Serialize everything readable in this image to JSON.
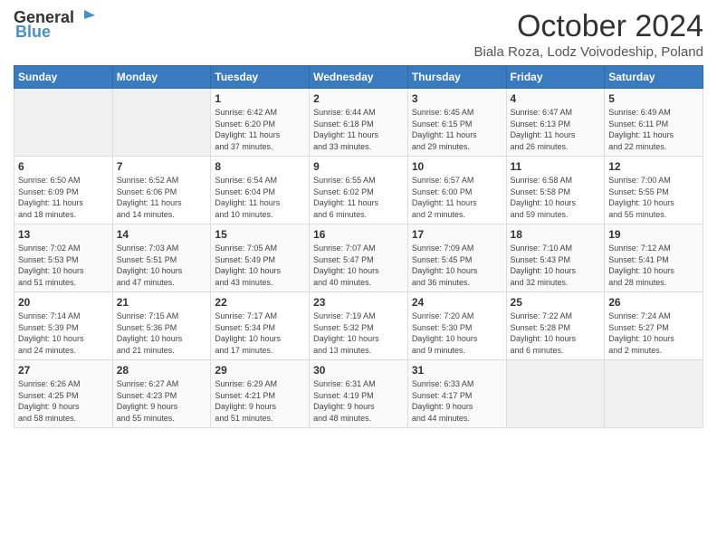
{
  "header": {
    "logo_line1": "General",
    "logo_line2": "Blue",
    "month": "October 2024",
    "location": "Biala Roza, Lodz Voivodeship, Poland"
  },
  "days_of_week": [
    "Sunday",
    "Monday",
    "Tuesday",
    "Wednesday",
    "Thursday",
    "Friday",
    "Saturday"
  ],
  "weeks": [
    [
      {
        "day": "",
        "content": ""
      },
      {
        "day": "",
        "content": ""
      },
      {
        "day": "1",
        "content": "Sunrise: 6:42 AM\nSunset: 6:20 PM\nDaylight: 11 hours\nand 37 minutes."
      },
      {
        "day": "2",
        "content": "Sunrise: 6:44 AM\nSunset: 6:18 PM\nDaylight: 11 hours\nand 33 minutes."
      },
      {
        "day": "3",
        "content": "Sunrise: 6:45 AM\nSunset: 6:15 PM\nDaylight: 11 hours\nand 29 minutes."
      },
      {
        "day": "4",
        "content": "Sunrise: 6:47 AM\nSunset: 6:13 PM\nDaylight: 11 hours\nand 26 minutes."
      },
      {
        "day": "5",
        "content": "Sunrise: 6:49 AM\nSunset: 6:11 PM\nDaylight: 11 hours\nand 22 minutes."
      }
    ],
    [
      {
        "day": "6",
        "content": "Sunrise: 6:50 AM\nSunset: 6:09 PM\nDaylight: 11 hours\nand 18 minutes."
      },
      {
        "day": "7",
        "content": "Sunrise: 6:52 AM\nSunset: 6:06 PM\nDaylight: 11 hours\nand 14 minutes."
      },
      {
        "day": "8",
        "content": "Sunrise: 6:54 AM\nSunset: 6:04 PM\nDaylight: 11 hours\nand 10 minutes."
      },
      {
        "day": "9",
        "content": "Sunrise: 6:55 AM\nSunset: 6:02 PM\nDaylight: 11 hours\nand 6 minutes."
      },
      {
        "day": "10",
        "content": "Sunrise: 6:57 AM\nSunset: 6:00 PM\nDaylight: 11 hours\nand 2 minutes."
      },
      {
        "day": "11",
        "content": "Sunrise: 6:58 AM\nSunset: 5:58 PM\nDaylight: 10 hours\nand 59 minutes."
      },
      {
        "day": "12",
        "content": "Sunrise: 7:00 AM\nSunset: 5:55 PM\nDaylight: 10 hours\nand 55 minutes."
      }
    ],
    [
      {
        "day": "13",
        "content": "Sunrise: 7:02 AM\nSunset: 5:53 PM\nDaylight: 10 hours\nand 51 minutes."
      },
      {
        "day": "14",
        "content": "Sunrise: 7:03 AM\nSunset: 5:51 PM\nDaylight: 10 hours\nand 47 minutes."
      },
      {
        "day": "15",
        "content": "Sunrise: 7:05 AM\nSunset: 5:49 PM\nDaylight: 10 hours\nand 43 minutes."
      },
      {
        "day": "16",
        "content": "Sunrise: 7:07 AM\nSunset: 5:47 PM\nDaylight: 10 hours\nand 40 minutes."
      },
      {
        "day": "17",
        "content": "Sunrise: 7:09 AM\nSunset: 5:45 PM\nDaylight: 10 hours\nand 36 minutes."
      },
      {
        "day": "18",
        "content": "Sunrise: 7:10 AM\nSunset: 5:43 PM\nDaylight: 10 hours\nand 32 minutes."
      },
      {
        "day": "19",
        "content": "Sunrise: 7:12 AM\nSunset: 5:41 PM\nDaylight: 10 hours\nand 28 minutes."
      }
    ],
    [
      {
        "day": "20",
        "content": "Sunrise: 7:14 AM\nSunset: 5:39 PM\nDaylight: 10 hours\nand 24 minutes."
      },
      {
        "day": "21",
        "content": "Sunrise: 7:15 AM\nSunset: 5:36 PM\nDaylight: 10 hours\nand 21 minutes."
      },
      {
        "day": "22",
        "content": "Sunrise: 7:17 AM\nSunset: 5:34 PM\nDaylight: 10 hours\nand 17 minutes."
      },
      {
        "day": "23",
        "content": "Sunrise: 7:19 AM\nSunset: 5:32 PM\nDaylight: 10 hours\nand 13 minutes."
      },
      {
        "day": "24",
        "content": "Sunrise: 7:20 AM\nSunset: 5:30 PM\nDaylight: 10 hours\nand 9 minutes."
      },
      {
        "day": "25",
        "content": "Sunrise: 7:22 AM\nSunset: 5:28 PM\nDaylight: 10 hours\nand 6 minutes."
      },
      {
        "day": "26",
        "content": "Sunrise: 7:24 AM\nSunset: 5:27 PM\nDaylight: 10 hours\nand 2 minutes."
      }
    ],
    [
      {
        "day": "27",
        "content": "Sunrise: 6:26 AM\nSunset: 4:25 PM\nDaylight: 9 hours\nand 58 minutes."
      },
      {
        "day": "28",
        "content": "Sunrise: 6:27 AM\nSunset: 4:23 PM\nDaylight: 9 hours\nand 55 minutes."
      },
      {
        "day": "29",
        "content": "Sunrise: 6:29 AM\nSunset: 4:21 PM\nDaylight: 9 hours\nand 51 minutes."
      },
      {
        "day": "30",
        "content": "Sunrise: 6:31 AM\nSunset: 4:19 PM\nDaylight: 9 hours\nand 48 minutes."
      },
      {
        "day": "31",
        "content": "Sunrise: 6:33 AM\nSunset: 4:17 PM\nDaylight: 9 hours\nand 44 minutes."
      },
      {
        "day": "",
        "content": ""
      },
      {
        "day": "",
        "content": ""
      }
    ]
  ]
}
